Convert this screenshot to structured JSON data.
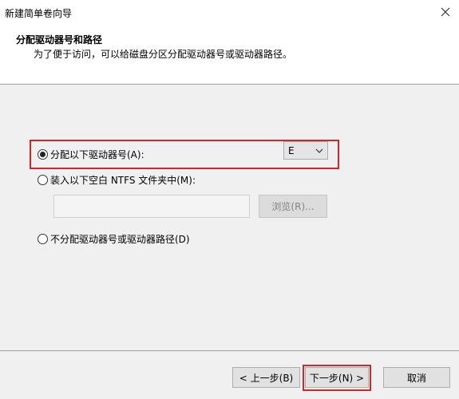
{
  "window": {
    "title": "新建简单卷向导"
  },
  "header": {
    "title": "分配驱动器号和路径",
    "subtitle": "为了便于访问，可以给磁盘分区分配驱动器号或驱动器路径。"
  },
  "options": {
    "assign_letter": {
      "label": "分配以下驱动器号(A):",
      "selected": true
    },
    "drive_letter": {
      "value": "E"
    },
    "mount_folder": {
      "label": "装入以下空白 NTFS 文件夹中(M):",
      "selected": false
    },
    "path_input": {
      "value": ""
    },
    "browse_label": "浏览(R)...",
    "no_assign": {
      "label": "不分配驱动器号或驱动器路径(D)",
      "selected": false
    }
  },
  "footer": {
    "back_label": "< 上一步(B)",
    "next_label": "下一步(N) >",
    "cancel_label": "取消"
  },
  "colors": {
    "highlight": "#d4262a",
    "dialog_bg": "#f0f0f0",
    "header_bg": "#ffffff"
  }
}
